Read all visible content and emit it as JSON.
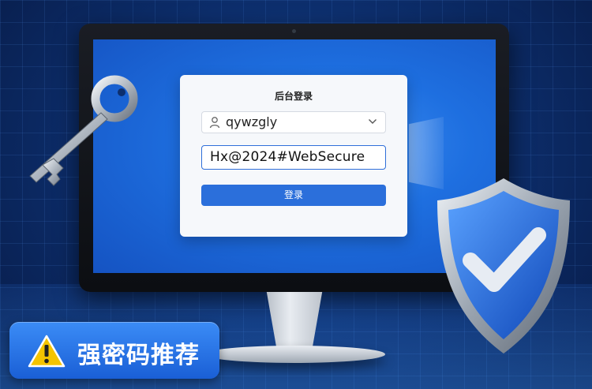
{
  "login_card": {
    "title": "后台登录",
    "username_value": "qywzgly",
    "password_value": "Hx@2024#WebSecure",
    "login_button": "登录"
  },
  "badge": {
    "text": "强密码推荐",
    "icon": "warning-icon"
  },
  "decorations": {
    "key_icon": "key-icon",
    "shield_icon": "shield-check-icon",
    "user_icon": "user-icon",
    "dropdown_icon": "chevron-down-icon"
  },
  "colors": {
    "accent": "#2b6fdb",
    "badge": "#1a5fd6",
    "warning": "#f5c400"
  }
}
